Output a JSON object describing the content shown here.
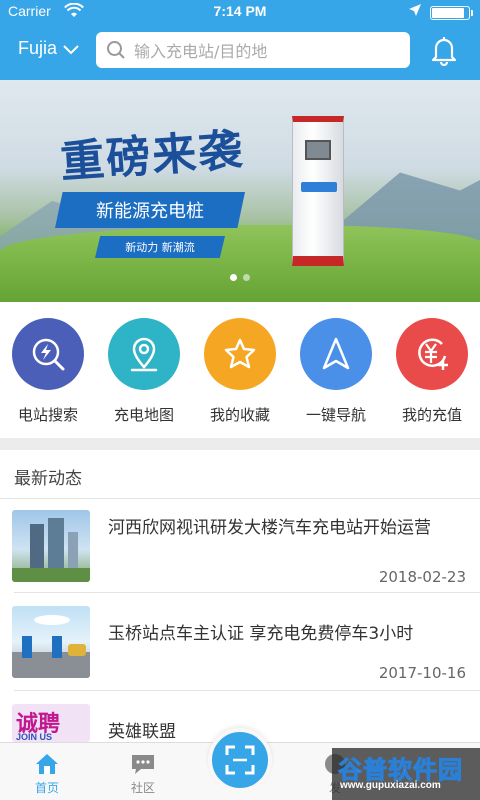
{
  "status_bar": {
    "carrier": "Carrier",
    "time": "7:14 PM",
    "battery_level": 0.9,
    "icons": [
      "wifi-icon",
      "location-arrow-icon",
      "battery-icon"
    ]
  },
  "header": {
    "city": "Fujia",
    "search_placeholder": "输入充电站/目的地",
    "icons": [
      "chevron-down-icon",
      "search-icon",
      "bell-icon"
    ]
  },
  "banner": {
    "headline": "重磅来袭",
    "ribbon_text": "新能源充电桩",
    "tagline": "新动力 新潮流",
    "slide_count": 2,
    "active_slide": 0
  },
  "quick_actions": [
    {
      "label": "电站搜索",
      "icon": "lightning-search-icon",
      "color": "#4b5fb8"
    },
    {
      "label": "充电地图",
      "icon": "map-pin-icon",
      "color": "#2fb3c6"
    },
    {
      "label": "我的收藏",
      "icon": "star-icon",
      "color": "#f5a623"
    },
    {
      "label": "一键导航",
      "icon": "navigation-arrow-icon",
      "color": "#4a8fe8"
    },
    {
      "label": "我的充值",
      "icon": "yen-coin-icon",
      "color": "#e94b4b"
    }
  ],
  "news": {
    "heading": "最新动态",
    "items": [
      {
        "title": "河西欣网视讯研发大楼汽车充电站开始运营",
        "date": "2018-02-23"
      },
      {
        "title": "玉桥站点车主认证  享充电免费停车3小时",
        "date": "2017-10-16"
      },
      {
        "title": "英雄联盟",
        "date": "",
        "thumb_text": "诚聘",
        "thumb_subtext": "JOIN US"
      }
    ]
  },
  "tabbar": {
    "tabs": [
      {
        "label": "首页",
        "icon": "home-icon",
        "active": true
      },
      {
        "label": "社区",
        "icon": "chat-bubble-icon",
        "active": false
      },
      {
        "label": "发",
        "icon": "discover-icon",
        "active": false
      }
    ],
    "center_button_icon": "scan-icon"
  },
  "watermark": {
    "title": "谷普软件园",
    "url": "www.gupuxiazai.com"
  },
  "colors": {
    "primary": "#37a6e8",
    "separator": "#ececec"
  }
}
